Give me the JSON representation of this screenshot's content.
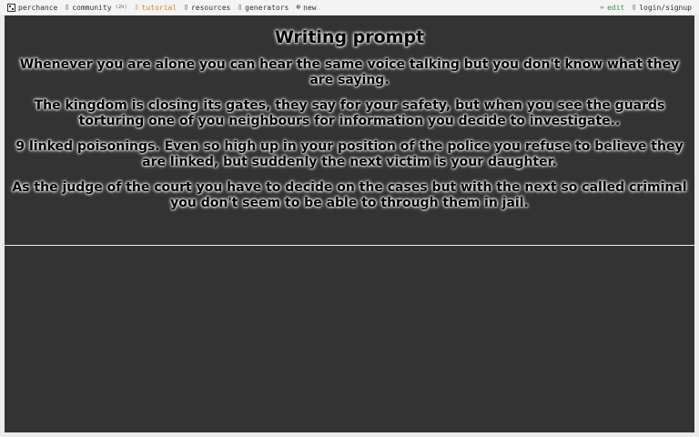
{
  "nav": {
    "left": [
      {
        "label": "perchance",
        "icon": "dice-logo-icon"
      },
      {
        "label": "community",
        "count": "(2h)",
        "icon": "chat-bubble-icon"
      },
      {
        "label": "tutorial",
        "icon": "book-icon"
      },
      {
        "label": "resources",
        "icon": "folder-icon"
      },
      {
        "label": "generators",
        "icon": "list-icon"
      },
      {
        "label": "new",
        "icon": "plus-circle-icon"
      }
    ],
    "right": [
      {
        "label": "edit",
        "icon": "pencil-icon"
      },
      {
        "label": "login/signup",
        "icon": "user-icon"
      }
    ]
  },
  "colors": {
    "tutorial": "#e0821c",
    "edit": "#3f9a3f",
    "panel": "#333333"
  },
  "output": {
    "title": "Writing prompt",
    "prompts": [
      "Whenever you are alone you can hear the same voice talking but you don't know what they are saying.",
      "The kingdom is closing its gates, they say for your safety, but when you see the guards torturing one of you neighbours for information you decide to investigate..",
      "9 linked poisonings. Even so high up in your position of the police you refuse to believe they are linked, but suddenly the next victim is your daughter.",
      "As the judge of the court you have to decide on the cases but with the next so called criminal you don't seem to be able to through them in jail."
    ]
  }
}
